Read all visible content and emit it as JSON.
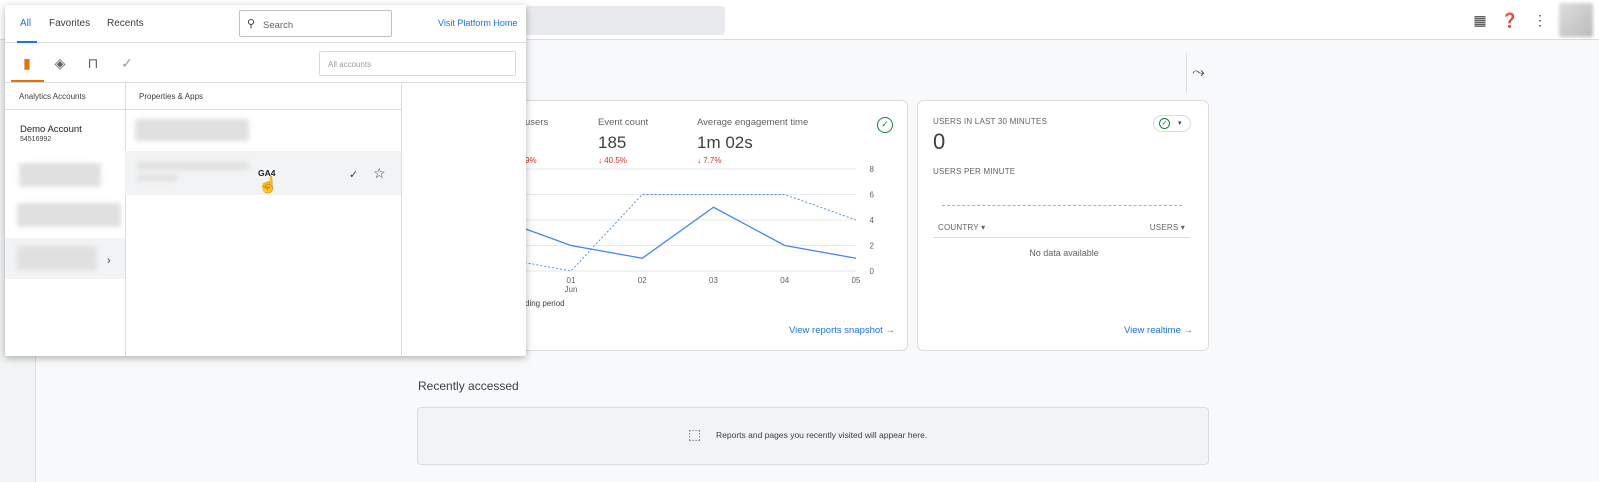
{
  "popup": {
    "tabs": [
      "All",
      "Favorites",
      "Recents"
    ],
    "search_placeholder": "Search",
    "visit_link": "Visit Platform Home",
    "accounts_filter_placeholder": "All accounts",
    "col_accounts": "Analytics Accounts",
    "col_properties": "Properties & Apps",
    "account_name": "Demo Account",
    "account_id": "54516992",
    "property_suffix": "GA4"
  },
  "card1": {
    "metric1_label": "users",
    "metric1_change": "9%",
    "metric2_label": "Event count",
    "metric2_value": "185",
    "metric2_change": "↓ 40.5%",
    "metric3_label": "Average engagement time",
    "metric3_value": "1m 02s",
    "metric3_change": "↓ 7.7%",
    "legend_fragment": "ding period",
    "link": "View reports snapshot"
  },
  "chart_data": {
    "type": "line",
    "categories": [
      "01 Jun",
      "02",
      "03",
      "04",
      "05"
    ],
    "y_ticks": [
      0,
      2,
      4,
      6,
      8
    ],
    "series": [
      {
        "values": [
          2,
          1,
          5,
          2,
          1
        ]
      },
      {
        "values": [
          0,
          6,
          6,
          6,
          4
        ]
      }
    ],
    "ylim": [
      0,
      8
    ]
  },
  "card2": {
    "title": "USERS IN LAST 30 MINUTES",
    "value": "0",
    "per_minute": "USERS PER MINUTE",
    "col_country": "COUNTRY",
    "col_users": "USERS",
    "empty": "No data available",
    "link": "View realtime"
  },
  "recent": {
    "title": "Recently accessed",
    "message": "Reports and pages you recently visited will appear here."
  }
}
